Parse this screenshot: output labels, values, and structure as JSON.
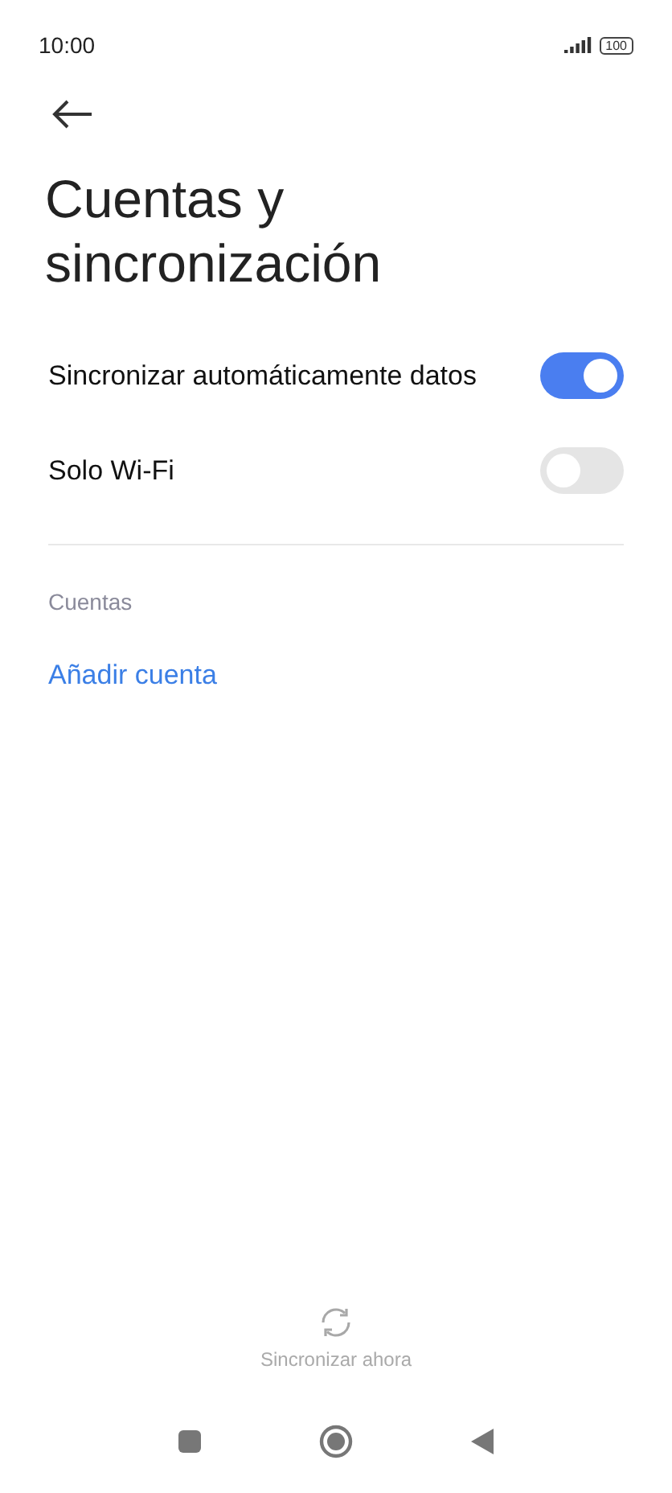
{
  "status_bar": {
    "time": "10:00",
    "battery": "100"
  },
  "title": "Cuentas y sincronización",
  "settings": [
    {
      "label": "Sincronizar automáticamente datos",
      "on": true
    },
    {
      "label": "Solo Wi-Fi",
      "on": false
    }
  ],
  "section": "Cuentas",
  "add_account": "Añadir cuenta",
  "sync_now": "Sincronizar ahora"
}
